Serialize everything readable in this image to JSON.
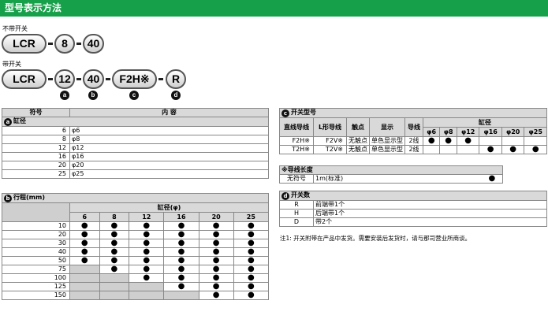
{
  "title": "型号表示方法",
  "no_switch": {
    "label": "不带开关",
    "parts": [
      "LCR",
      "8",
      "40"
    ]
  },
  "with_switch": {
    "label": "带开关",
    "parts": [
      "LCR",
      "12",
      "40",
      "F2H※",
      "R"
    ],
    "markers": [
      "a",
      "b",
      "c",
      "d"
    ]
  },
  "table_a": {
    "headers": [
      "符号",
      "内  容"
    ],
    "section": "缸径",
    "rows": [
      [
        "6",
        "φ6"
      ],
      [
        "8",
        "φ8"
      ],
      [
        "12",
        "φ12"
      ],
      [
        "16",
        "φ16"
      ],
      [
        "20",
        "φ20"
      ],
      [
        "25",
        "φ25"
      ]
    ]
  },
  "table_b": {
    "section": "行程(mm)",
    "group_header": "缸径(φ)",
    "bores": [
      "6",
      "8",
      "12",
      "16",
      "20",
      "25"
    ],
    "rows": [
      {
        "stroke": "10",
        "marks": [
          true,
          true,
          true,
          true,
          true,
          true
        ]
      },
      {
        "stroke": "20",
        "marks": [
          true,
          true,
          true,
          true,
          true,
          true
        ]
      },
      {
        "stroke": "30",
        "marks": [
          true,
          true,
          true,
          true,
          true,
          true
        ]
      },
      {
        "stroke": "40",
        "marks": [
          true,
          true,
          true,
          true,
          true,
          true
        ]
      },
      {
        "stroke": "50",
        "marks": [
          true,
          true,
          true,
          true,
          true,
          true
        ]
      },
      {
        "stroke": "75",
        "marks": [
          false,
          true,
          true,
          true,
          true,
          true
        ]
      },
      {
        "stroke": "100",
        "marks": [
          false,
          false,
          true,
          true,
          true,
          true
        ]
      },
      {
        "stroke": "125",
        "marks": [
          false,
          false,
          false,
          true,
          true,
          true
        ]
      },
      {
        "stroke": "150",
        "marks": [
          false,
          false,
          false,
          false,
          true,
          true
        ]
      }
    ]
  },
  "table_c": {
    "section": "开关型号",
    "headers": [
      "直线导线",
      "L形导线",
      "触点",
      "显示",
      "导线",
      "缸径"
    ],
    "bores": [
      "φ6",
      "φ8",
      "φ12",
      "φ16",
      "φ20",
      "φ25"
    ],
    "rows": [
      {
        "straight": "F2H※",
        "l_type": "F2V※",
        "contact": "无触点",
        "display": "单色显示型",
        "wire": "2线",
        "marks": [
          true,
          true,
          true,
          false,
          false,
          false
        ]
      },
      {
        "straight": "T2H※",
        "l_type": "T2V※",
        "contact": "无触点",
        "display": "单色显示型",
        "wire": "2线",
        "marks": [
          false,
          false,
          false,
          true,
          true,
          true
        ]
      }
    ],
    "length_section": "※导线长度",
    "length_row": {
      "symbol": "无符号",
      "content": "1m(标准)"
    }
  },
  "table_d": {
    "section": "开关数",
    "rows": [
      [
        "R",
        "前端带1个"
      ],
      [
        "H",
        "后端带1个"
      ],
      [
        "D",
        "带2个"
      ]
    ]
  },
  "note": "注1: 开关附带在产品中发货。需要安装后发货时，请与那司营业所商谈。"
}
